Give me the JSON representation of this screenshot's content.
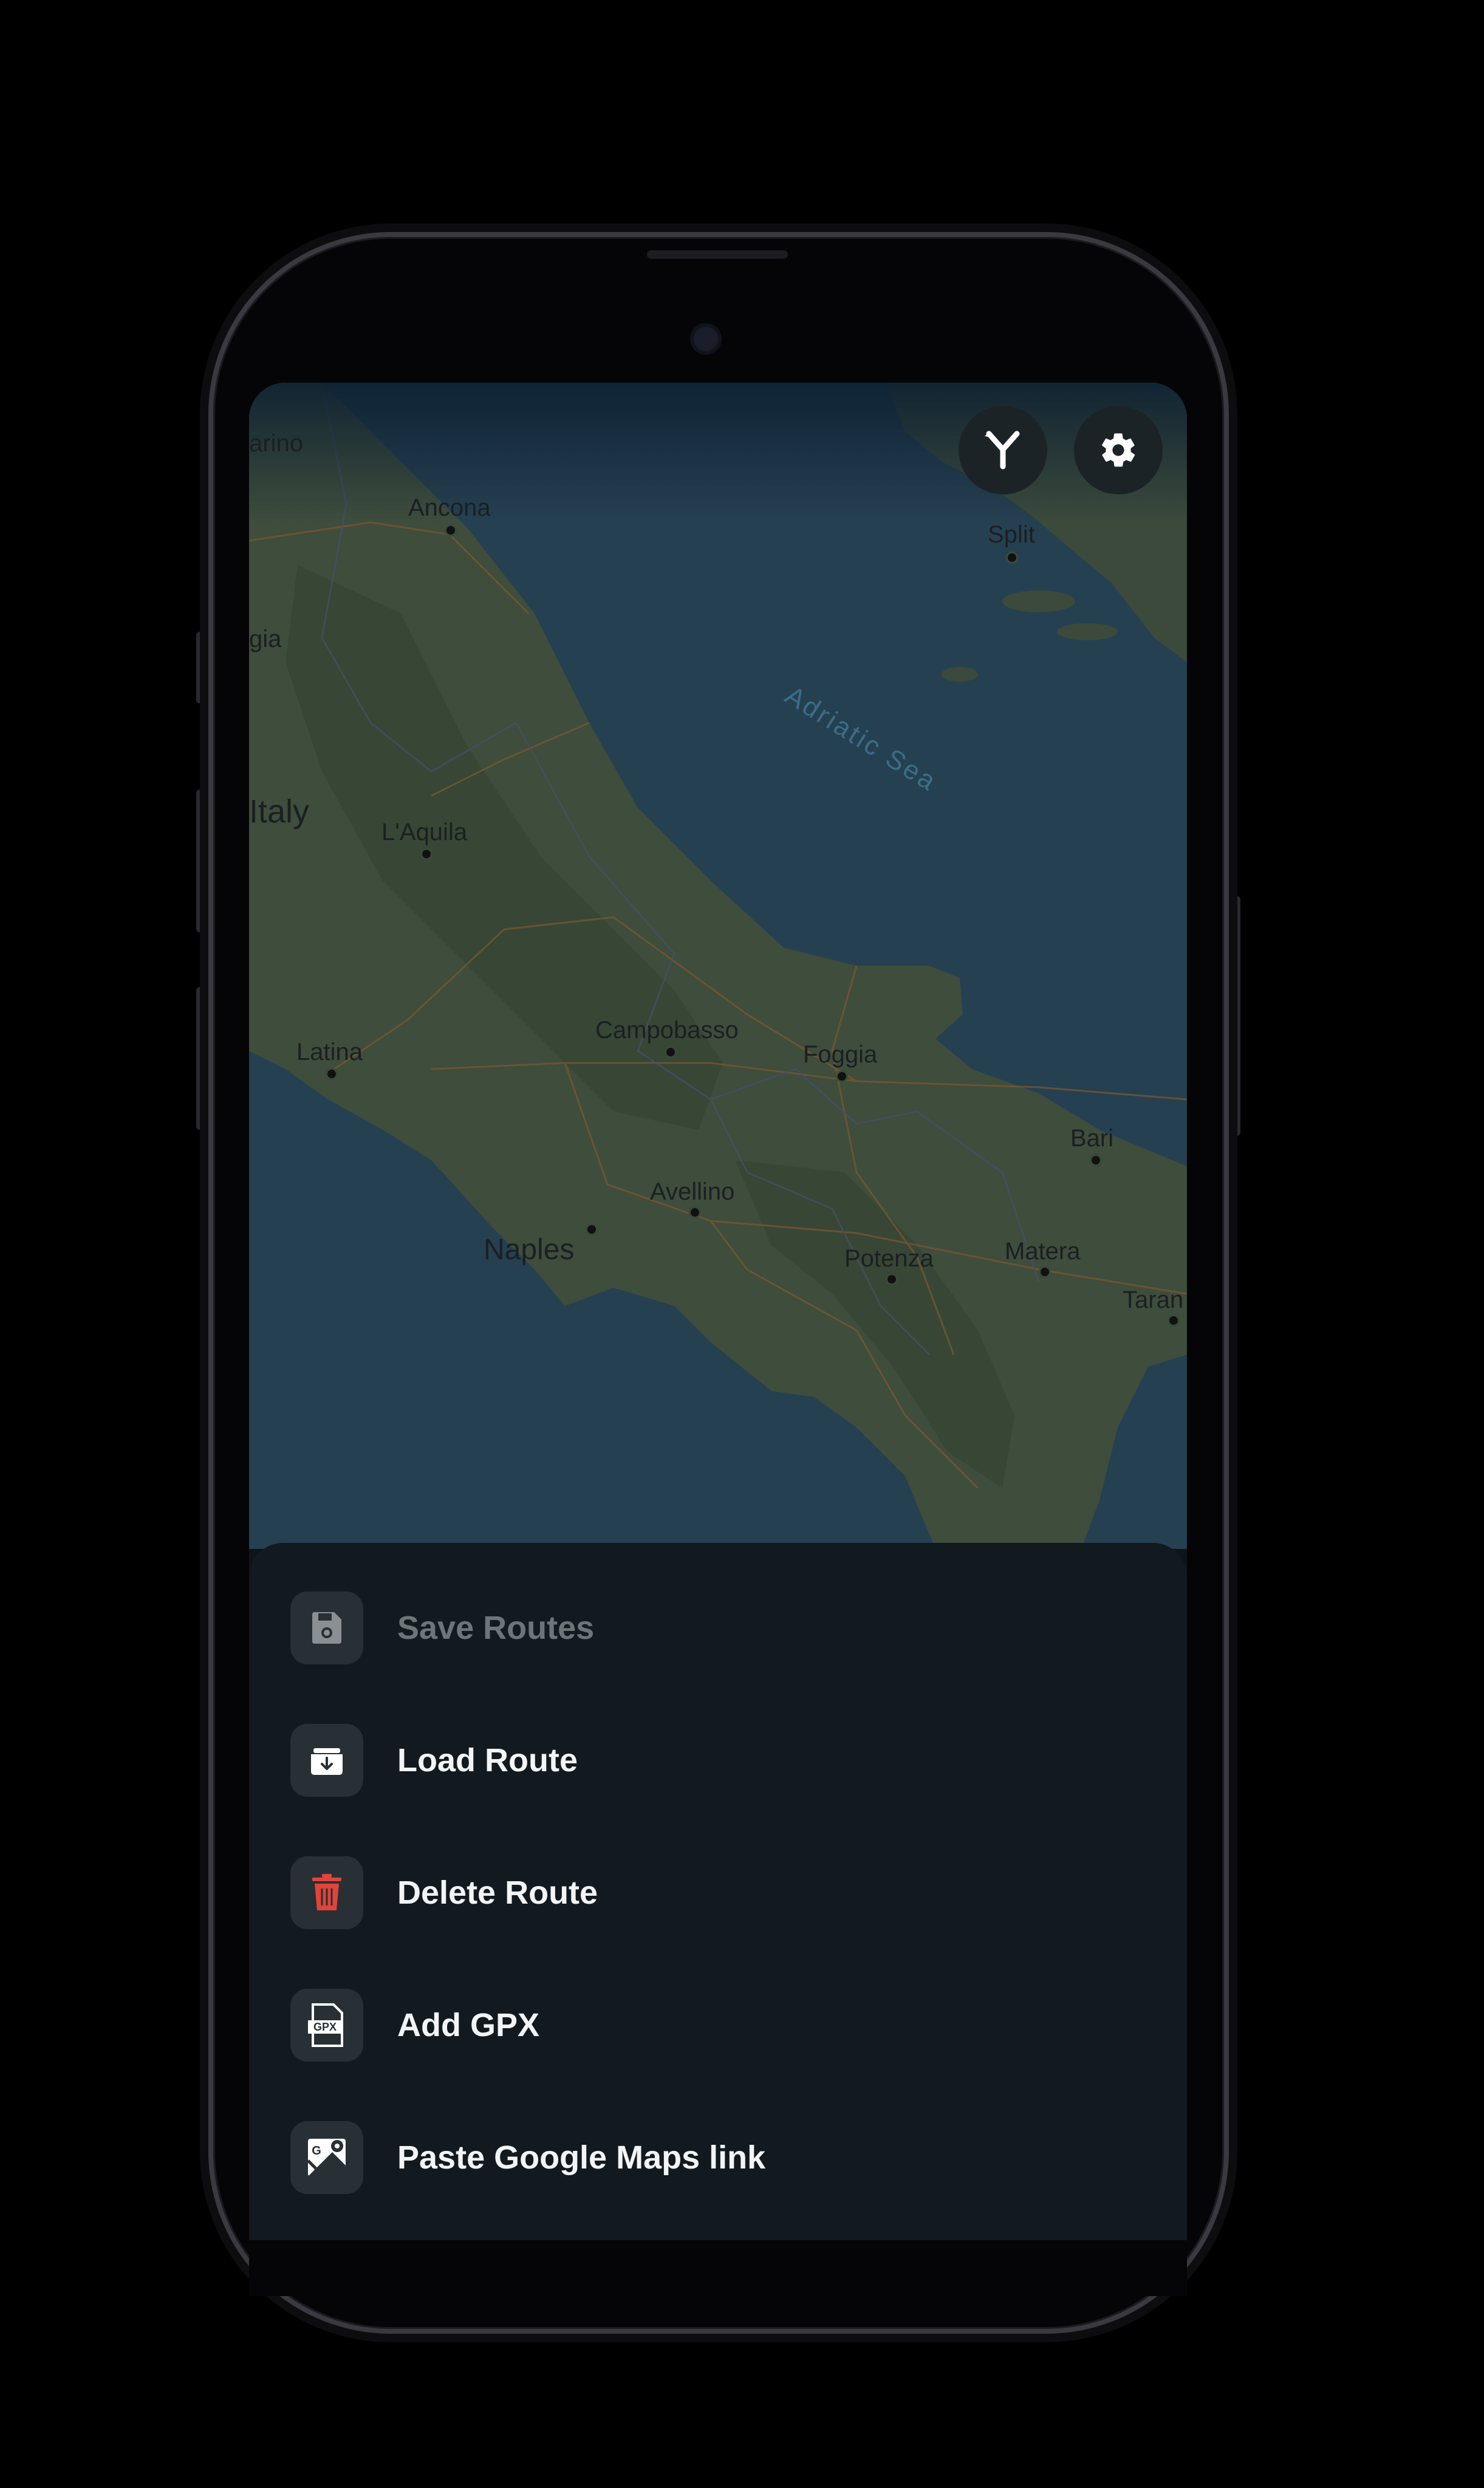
{
  "map": {
    "sea_label": "Adriatic Sea",
    "country_label": "Italy",
    "cities": [
      {
        "name": "arino"
      },
      {
        "name": "Ancona"
      },
      {
        "name": "Split"
      },
      {
        "name": "gia"
      },
      {
        "name": "L'Aquila"
      },
      {
        "name": "Campobasso"
      },
      {
        "name": "Foggia"
      },
      {
        "name": "Latina"
      },
      {
        "name": "Bari"
      },
      {
        "name": "Avellino"
      },
      {
        "name": "Naples"
      },
      {
        "name": "Potenza"
      },
      {
        "name": "Matera"
      },
      {
        "name": "Taran"
      }
    ]
  },
  "toolbar": {
    "route_icon": "route-split-icon",
    "settings_icon": "gear-icon"
  },
  "sheet": {
    "items": [
      {
        "label": "Save Routes",
        "icon": "save-icon",
        "enabled": false
      },
      {
        "label": "Load Route",
        "icon": "download-box-icon",
        "enabled": true
      },
      {
        "label": "Delete Route",
        "icon": "trash-icon",
        "enabled": true,
        "color": "#e0443a"
      },
      {
        "label": "Add GPX",
        "icon": "gpx-file-icon",
        "enabled": true
      },
      {
        "label": "Paste Google Maps link",
        "icon": "google-maps-icon",
        "enabled": true
      }
    ]
  },
  "colors": {
    "sheet_bg": "#121a1f",
    "icon_bg": "#283035",
    "delete_red": "#e0443a",
    "map_sea": "#2c4a5a",
    "map_land": "#4f5e45"
  }
}
